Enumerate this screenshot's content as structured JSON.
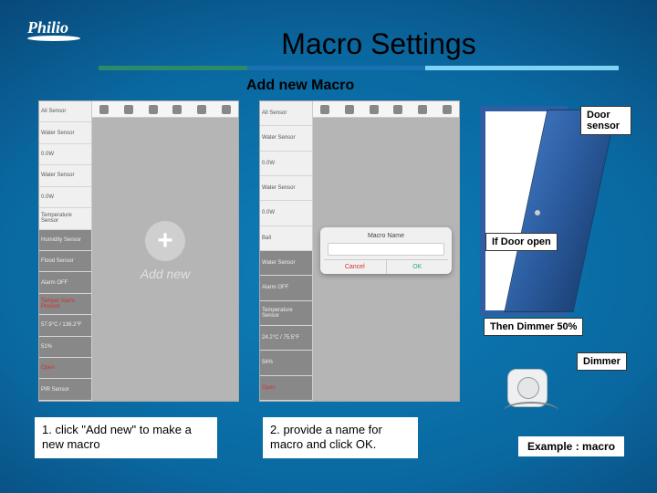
{
  "brand": "Philio",
  "title": "Macro Settings",
  "subtitle": "Add new Macro",
  "sidebar_items": [
    "All Sensor",
    "Water Sensor",
    "0.0W",
    "Water Sensor",
    "0.0W",
    "Temperature Sensor",
    "Humidity Sensor",
    "Flood Sensor",
    "Alarm OFF",
    "Tamper Alarm Present",
    "57.9°C / 136.2°F",
    "51%",
    "Open",
    "PIR Sensor"
  ],
  "sidebar_items_b": [
    "All Sensor",
    "Water Sensor",
    "0.0W",
    "Water Sensor",
    "0.0W",
    "Ball",
    "Water Sensor",
    "Alarm OFF",
    "Temperature Sensor",
    "24.2°C / 75.5°F",
    "56%",
    "Open"
  ],
  "addnew": {
    "icon": "+",
    "label": "Add new"
  },
  "dialog": {
    "title": "Macro Name",
    "cancel": "Cancel",
    "ok": "OK"
  },
  "labels": {
    "door": "Door sensor",
    "if_cond": "If Door open",
    "then_act": "Then Dimmer 50%",
    "dimmer": "Dimmer"
  },
  "captions": {
    "c1": "1. click \"Add new\" to make a new macro",
    "c2": "2. provide a name for macro and click OK."
  },
  "example": "Example :  macro"
}
